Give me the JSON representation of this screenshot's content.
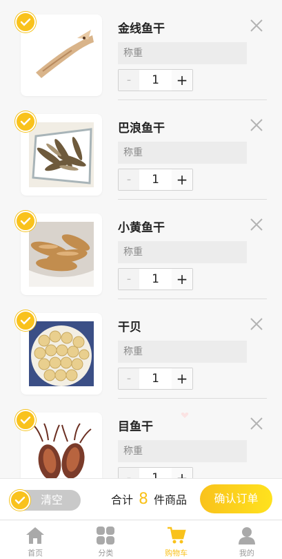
{
  "cart": {
    "items": [
      {
        "name": "金线鱼干",
        "weight_placeholder": "称重",
        "qty": "1",
        "minus": "-",
        "plus": "+",
        "selected": true
      },
      {
        "name": "巴浪鱼干",
        "weight_placeholder": "称重",
        "qty": "1",
        "minus": "-",
        "plus": "+",
        "selected": true
      },
      {
        "name": "小黄鱼干",
        "weight_placeholder": "称重",
        "qty": "1",
        "minus": "-",
        "plus": "+",
        "selected": true
      },
      {
        "name": "干贝",
        "weight_placeholder": "称重",
        "qty": "1",
        "minus": "-",
        "plus": "+",
        "selected": true
      },
      {
        "name": "目鱼干",
        "weight_placeholder": "称重",
        "qty": "1",
        "minus": "-",
        "plus": "+",
        "selected": true
      }
    ]
  },
  "footer": {
    "clear_label": "清空",
    "total_prefix": "合计",
    "total_count": "8",
    "total_suffix": "件商品",
    "confirm_label": "确认订单"
  },
  "tabbar": {
    "tabs": [
      {
        "label": "首页",
        "icon": "home-icon",
        "active": false
      },
      {
        "label": "分类",
        "icon": "grid-icon",
        "active": false
      },
      {
        "label": "购物车",
        "icon": "cart-icon",
        "active": true
      },
      {
        "label": "我的",
        "icon": "user-icon",
        "active": false
      }
    ]
  },
  "colors": {
    "accent": "#f9c21c",
    "background": "#f7f7f7"
  }
}
